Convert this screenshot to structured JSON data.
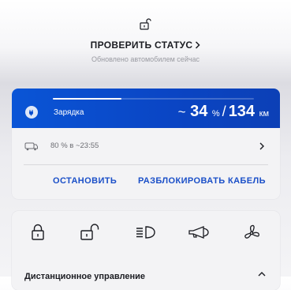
{
  "status": {
    "title": "ПРОВЕРИТЬ СТАТУС",
    "subtitle": "Обновлено автомобилем сейчас"
  },
  "charging": {
    "label": "Зарядка",
    "range_prefix": "~",
    "percent": "34",
    "percent_unit": "%",
    "separator": "/",
    "km": "134",
    "km_unit": "км",
    "progress": 0.34,
    "target_text": "80 % в ~23:55",
    "stop_button": "ОСТАНОВИТЬ",
    "unlock_cable_button": "РАЗБЛОКИРОВАТЬ КАБЕЛЬ"
  },
  "remote": {
    "title": "Дистанционное управление",
    "icons": [
      "lock-icon",
      "unlock-icon",
      "headlights-icon",
      "horn-icon",
      "fan-icon"
    ]
  },
  "colors": {
    "accent_blue": "#0a4fcf",
    "button_text": "#1a4fc8",
    "card_bg": "#f3f3f5"
  }
}
